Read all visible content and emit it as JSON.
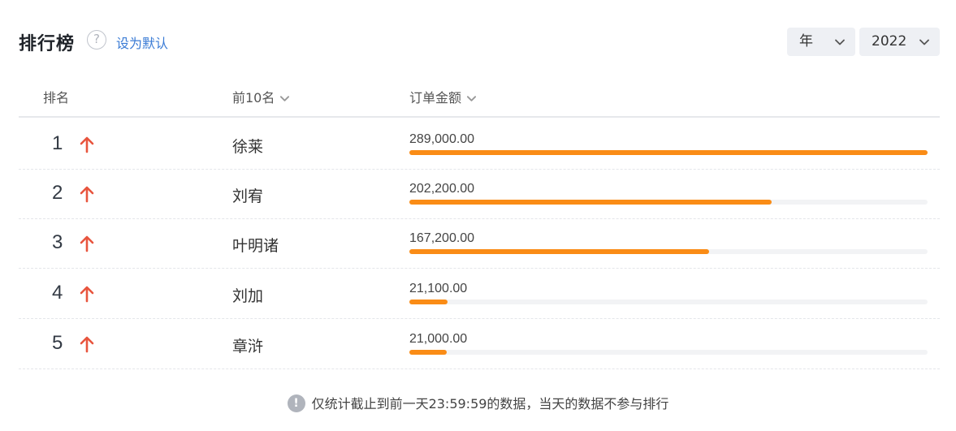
{
  "header": {
    "title": "排行榜",
    "help_icon": "?",
    "set_default_label": "设为默认",
    "period_select": {
      "value": "年"
    },
    "year_select": {
      "value": "2022"
    }
  },
  "table": {
    "columns": [
      {
        "label": "排名"
      },
      {
        "label": "前10名"
      },
      {
        "label": "订单金额"
      }
    ],
    "rows": [
      {
        "rank": "1",
        "trend": "up",
        "name": "徐莱",
        "amount": "289,000.00",
        "value": 289000
      },
      {
        "rank": "2",
        "trend": "up",
        "name": "刘宥",
        "amount": "202,200.00",
        "value": 202200
      },
      {
        "rank": "3",
        "trend": "up",
        "name": "叶明诸",
        "amount": "167,200.00",
        "value": 167200
      },
      {
        "rank": "4",
        "trend": "up",
        "name": "刘加",
        "amount": "21,100.00",
        "value": 21100
      },
      {
        "rank": "5",
        "trend": "up",
        "name": "章浒",
        "amount": "21,000.00",
        "value": 21000
      }
    ],
    "max_value": 289000
  },
  "footer": {
    "info_icon": "!",
    "note": "仅统计截止到前一天23:59:59的数据，当天的数据不参与排行"
  },
  "colors": {
    "bar": "#fa8c16",
    "trend_up": "#e8553e",
    "link": "#3a7bd5"
  }
}
